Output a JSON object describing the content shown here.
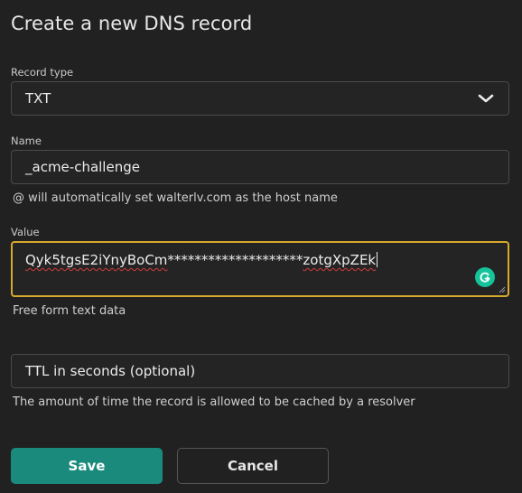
{
  "dialog": {
    "title": "Create a new DNS record"
  },
  "record_type": {
    "label": "Record type",
    "selected": "TXT",
    "icon": "chevron-down-icon"
  },
  "name": {
    "label": "Name",
    "value": "_acme-challenge",
    "hint": "@ will automatically set walterlv.com as the host name"
  },
  "value": {
    "label": "Value",
    "text_part1": "Qyk5tgsE2iYnyBoCm",
    "text_masked": "********************",
    "text_part2": "zotgXpZEk",
    "hint": "Free form text data",
    "grammarly_icon": "grammarly-icon"
  },
  "ttl": {
    "placeholder": "TTL in seconds (optional)",
    "hint": "The amount of time the record is allowed to be cached by a resolver"
  },
  "buttons": {
    "save": "Save",
    "cancel": "Cancel"
  },
  "colors": {
    "background": "#212121",
    "focus_border": "#d6a92b",
    "primary": "#1a8a7c",
    "grammarly": "#15c39a"
  }
}
